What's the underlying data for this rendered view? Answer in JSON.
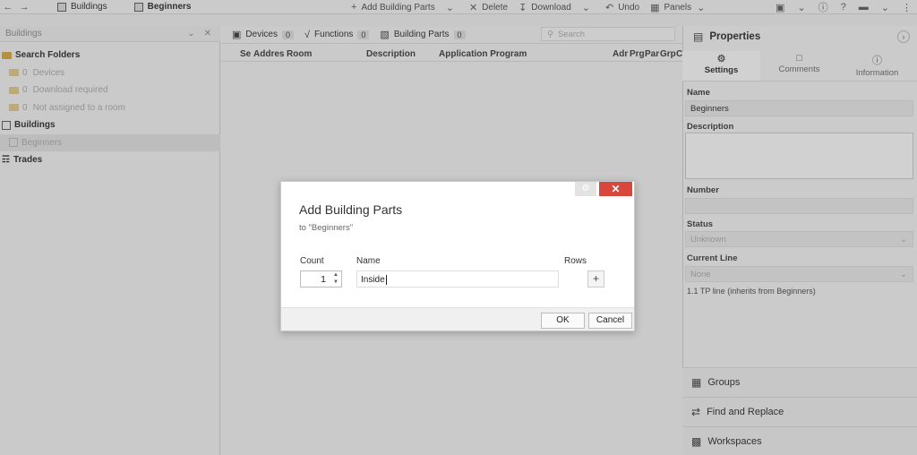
{
  "topbar": {
    "crumbs": [
      "Buildings",
      "Beginners"
    ],
    "tools": [
      {
        "icon": "plus",
        "label": "Add Building Parts"
      },
      {
        "icon": "x",
        "label": "Delete"
      },
      {
        "icon": "download",
        "label": "Download"
      },
      {
        "icon": "undo",
        "label": "Undo"
      },
      {
        "icon": "panels",
        "label": "Panels"
      }
    ]
  },
  "left": {
    "title": "Buildings",
    "tree": [
      {
        "label": "Search Folders",
        "count": ""
      },
      {
        "label": "Devices",
        "count": "0"
      },
      {
        "label": "Download required",
        "count": "0"
      },
      {
        "label": "Not assigned to a room",
        "count": "0"
      },
      {
        "label": "Buildings",
        "count": ""
      },
      {
        "label": "Beginners",
        "count": ""
      },
      {
        "label": "Trades",
        "count": ""
      }
    ]
  },
  "middle": {
    "tabs": [
      {
        "label": "Devices",
        "count": "0"
      },
      {
        "label": "Functions",
        "count": "0"
      },
      {
        "label": "Building Parts",
        "count": "0"
      }
    ],
    "search_placeholder": "Search",
    "columns": [
      "Se",
      "Addres",
      "Room",
      "Description",
      "Application Program",
      "Adr",
      "Prg",
      "Par",
      "Grp",
      "C"
    ]
  },
  "properties": {
    "title": "Properties",
    "tabs": [
      "Settings",
      "Comments",
      "Information"
    ],
    "name_label": "Name",
    "name_value": "Beginners",
    "description_label": "Description",
    "number_label": "Number",
    "status_label": "Status",
    "status_value": "Unknown",
    "current_line_label": "Current Line",
    "current_line_value": "None",
    "line_info": "1.1 TP line (inherits from Beginners)",
    "sections": [
      "Groups",
      "Find and Replace",
      "Workspaces"
    ]
  },
  "dialog": {
    "title": "Add Building Parts",
    "subtitle": "to \"Beginners\"",
    "count_label": "Count",
    "count_value": "1",
    "name_label": "Name",
    "name_value": "Inside",
    "rows_label": "Rows",
    "ok_label": "OK",
    "cancel_label": "Cancel"
  }
}
